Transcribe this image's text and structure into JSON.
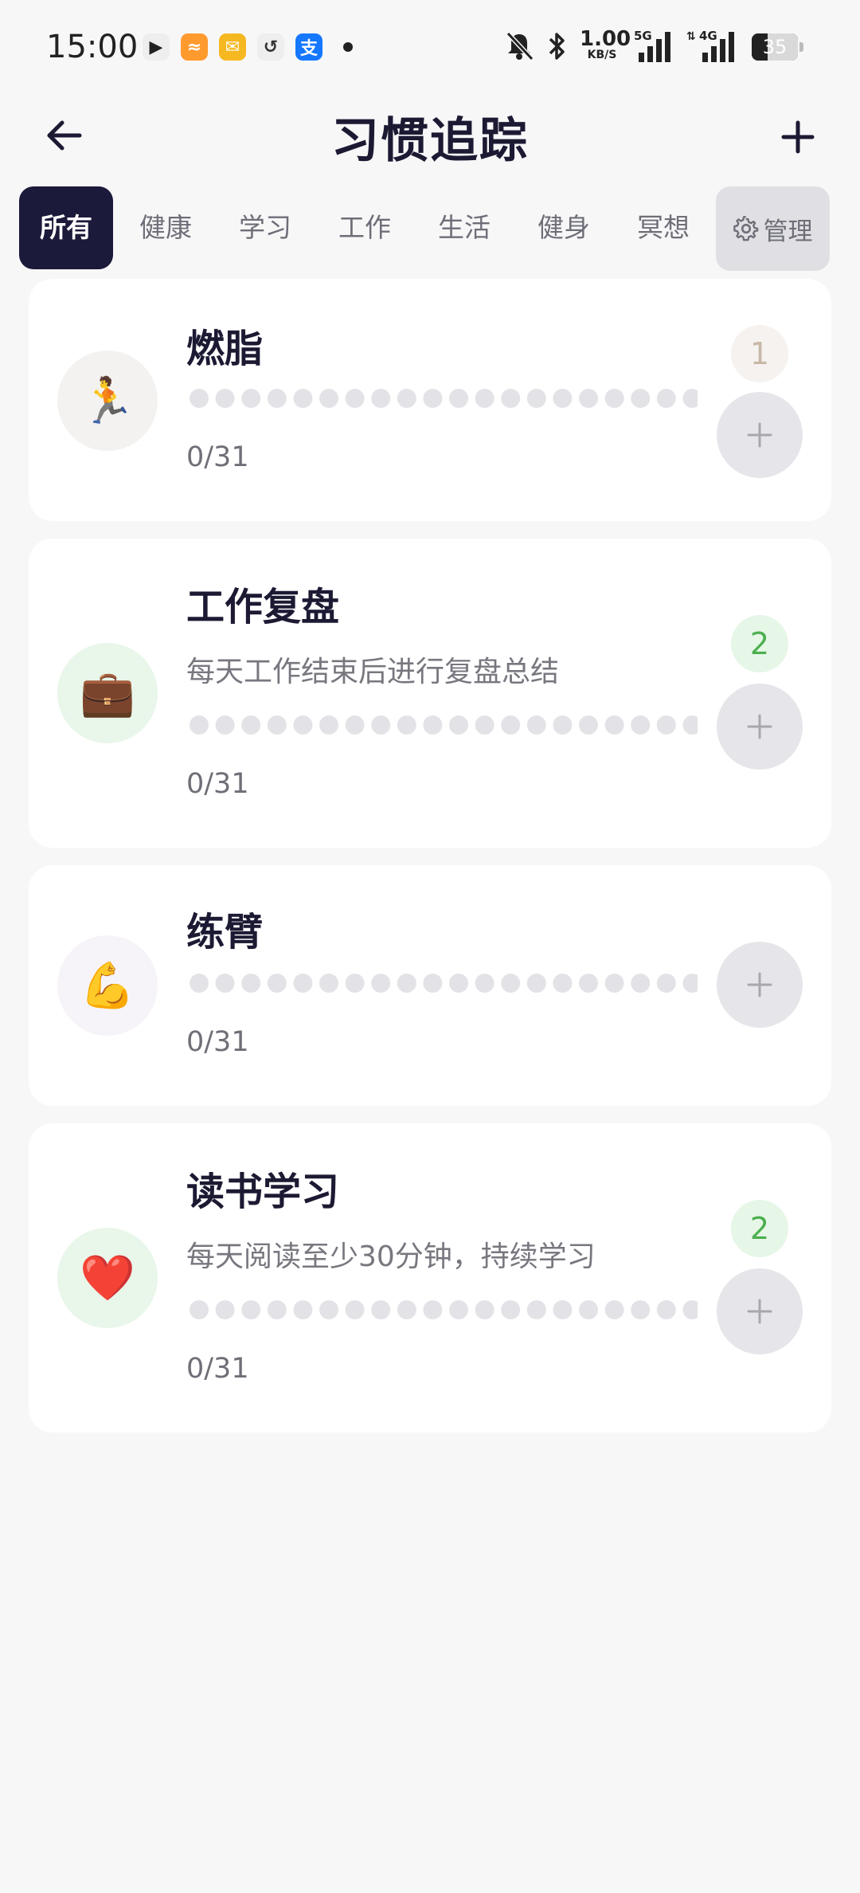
{
  "status_bar": {
    "time": "15:00",
    "apps": [
      {
        "name": "video-app-icon",
        "glyph": "▶",
        "color": "#eeeeee",
        "fg": "#222222"
      },
      {
        "name": "orange-app-icon",
        "glyph": "≈",
        "color": "#ff9a2e",
        "fg": "#ffffff"
      },
      {
        "name": "mail-app-icon",
        "glyph": "✉",
        "color": "#f6b821",
        "fg": "#ffffff"
      },
      {
        "name": "link-app-icon",
        "glyph": "↺",
        "color": "#eeeeee",
        "fg": "#333333"
      },
      {
        "name": "alipay-app-icon",
        "glyph": "支",
        "color": "#1677ff",
        "fg": "#ffffff"
      }
    ],
    "net_speed_value": "1.00",
    "net_speed_unit": "KB/S",
    "signal_1": "5G",
    "signal_2": "4G",
    "battery_level": "35",
    "battery_fraction": 0.35
  },
  "header": {
    "title": "习惯追踪"
  },
  "tabs": {
    "items": [
      {
        "label": "所有",
        "active": true
      },
      {
        "label": "健康"
      },
      {
        "label": "学习"
      },
      {
        "label": "工作"
      },
      {
        "label": "生活"
      },
      {
        "label": "健身"
      },
      {
        "label": "冥想"
      }
    ],
    "manage_label": "管理"
  },
  "habits": [
    {
      "name": "燃脂",
      "icon": "🏃",
      "icon_name": "running-icon",
      "icon_bg": "#f3f2f0",
      "description": "",
      "progress": "0/31",
      "days_total": 31,
      "days_done": 0,
      "streak": "1",
      "streak_color": "#c8b8a6",
      "streak_bg": "#f5f2ef"
    },
    {
      "name": "工作复盘",
      "icon": "💼",
      "icon_name": "briefcase-icon",
      "icon_bg": "#e9f6ea",
      "description": "每天工作结束后进行复盘总结",
      "progress": "0/31",
      "days_total": 31,
      "days_done": 0,
      "streak": "2",
      "streak_color": "#4caf50",
      "streak_bg": "#e6f6e7"
    },
    {
      "name": "练臂",
      "icon": "💪",
      "icon_name": "flexed-biceps-icon",
      "icon_bg": "#f6f4f8",
      "description": "",
      "progress": "0/31",
      "days_total": 31,
      "days_done": 0,
      "streak": "",
      "streak_color": "",
      "streak_bg": ""
    },
    {
      "name": "读书学习",
      "icon": "❤️",
      "icon_name": "red-heart-icon",
      "icon_bg": "#e9f6ea",
      "description": "每天阅读至少30分钟，持续学习",
      "progress": "0/31",
      "days_total": 31,
      "days_done": 0,
      "streak": "2",
      "streak_color": "#4caf50",
      "streak_bg": "#e6f6e7"
    }
  ],
  "colors": {
    "accent_dark": "#1c1a3a",
    "dot_empty": "#e3e3e7",
    "check_button": "#e6e6ea"
  }
}
